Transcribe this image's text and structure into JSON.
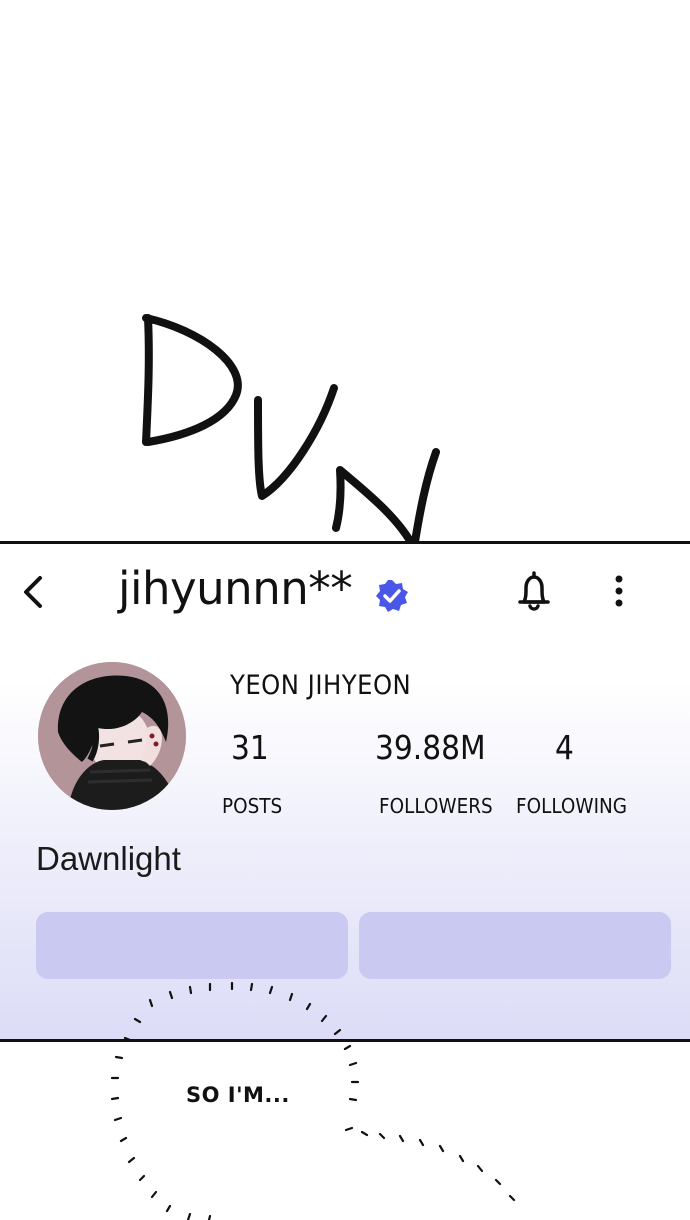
{
  "sfx_text": "DUN...",
  "header": {
    "username": "jihyunnn**",
    "back_icon": "chevron-left-icon",
    "verified_icon": "verified-badge-icon",
    "bell_icon": "bell-icon",
    "more_icon": "more-vertical-icon"
  },
  "profile": {
    "display_name": "YEON JIHYEON",
    "stats": [
      {
        "value": "31",
        "label": "POSTS"
      },
      {
        "value": "39.88M",
        "label": "FOLLOWERS"
      },
      {
        "value": "4",
        "label": "FOLLOWING"
      }
    ],
    "bio": "Dawnlight"
  },
  "colors": {
    "verified": "#4a56e6",
    "button": "#c9c9f2",
    "panel_tint": "#dcdcf7"
  },
  "speech_bubble": {
    "text": "SO I'M..."
  }
}
